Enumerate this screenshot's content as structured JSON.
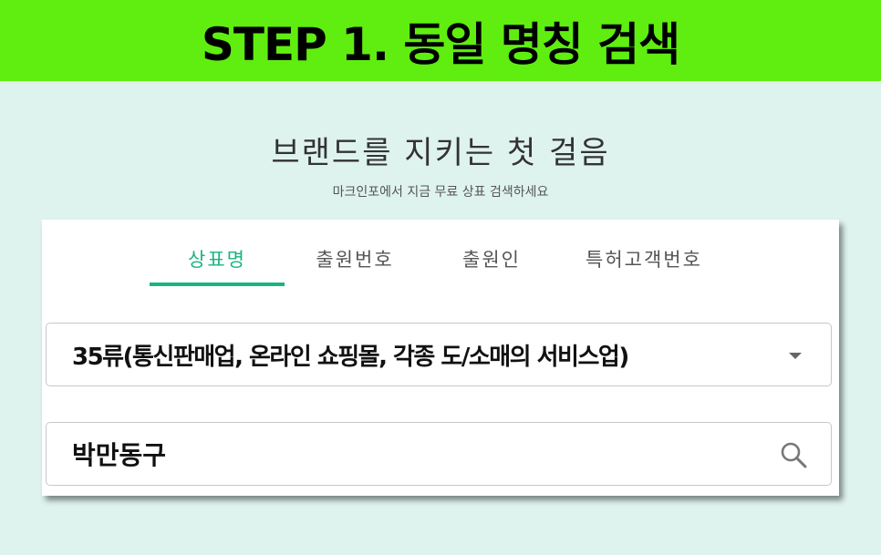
{
  "banner": {
    "title": "STEP 1. 동일 명칭 검색"
  },
  "hero": {
    "title": "브랜드를 지키는 첫 걸음",
    "subtitle": "마크인포에서 지금 무료 상표 검색하세요"
  },
  "tabs": [
    {
      "label": "상표명",
      "active": true
    },
    {
      "label": "출원번호",
      "active": false
    },
    {
      "label": "출원인",
      "active": false
    },
    {
      "label": "특허고객번호",
      "active": false
    }
  ],
  "classification_select": {
    "selected": "35류(통신판매업, 온라인 쇼핑몰, 각종 도/소매의 서비스업)"
  },
  "search": {
    "value": "박만동구"
  },
  "colors": {
    "banner": "#5fee0f",
    "accent": "#19b481",
    "background": "#dff3ee"
  },
  "icons": {
    "dropdown": "caret-down-icon",
    "search": "search-icon"
  }
}
